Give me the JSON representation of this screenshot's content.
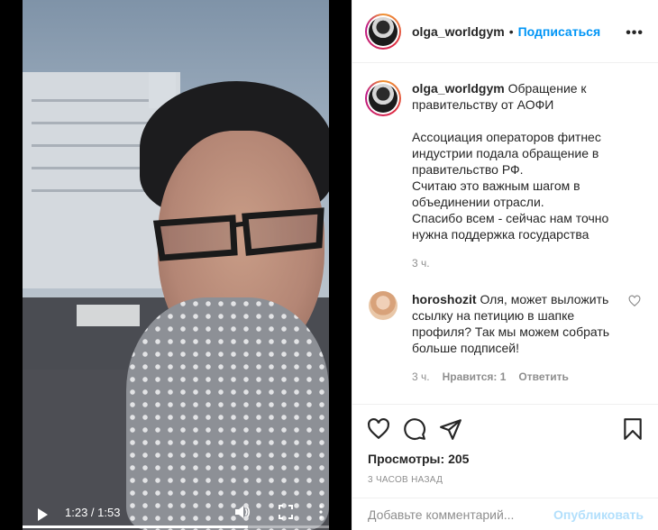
{
  "video": {
    "current_time": "1:23",
    "duration": "1:53",
    "progress": 0.734,
    "time_display": "1:23 / 1:53"
  },
  "post": {
    "username": "olga_worldgym",
    "separator": "•",
    "follow_label": "Подписаться",
    "menu_label": "•••",
    "caption_title": "Обращение к правительству от АОФИ",
    "caption_lines": [
      "Ассоциация операторов фитнес индустрии подала обращение в правительство РФ.",
      "Считаю это важным шагом в объединении отрасли.",
      "Спасибо всем - сейчас нам точно нужна поддержка государства"
    ],
    "caption_time": "3 ч."
  },
  "comments": [
    {
      "username": "horoshozit",
      "text": "Оля, может выложить ссылку на петицию в шапке профиля? Так мы можем собрать больше подписей!",
      "time": "3 ч.",
      "likes": "Нравится: 1",
      "reply": "Ответить"
    }
  ],
  "stats": {
    "views_label": "Просмотры:",
    "views_count": "205",
    "posted": "3 часов назад"
  },
  "add_comment": {
    "placeholder": "Добавьте комментарий...",
    "publish": "Опубликовать"
  },
  "colors": {
    "accent": "#0095f6",
    "publish_disabled": "#b2dffc",
    "muted": "#8e8e8e"
  }
}
